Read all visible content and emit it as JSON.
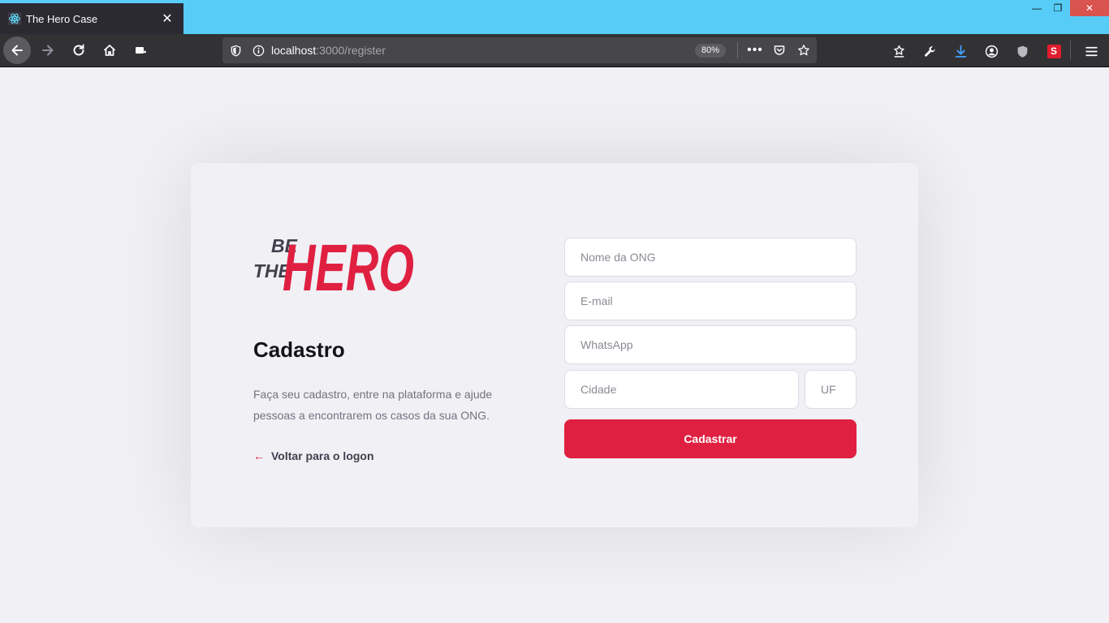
{
  "browser": {
    "tab_title": "The Hero Case",
    "url_host": "localhost",
    "url_rest": ":3000/register",
    "zoom": "80%",
    "colors": {
      "titlebar": "#56ccf7",
      "chrome": "#323234"
    }
  },
  "page": {
    "logo": {
      "line1": "BE",
      "line2": "THE",
      "word": "HERO"
    },
    "heading": "Cadastro",
    "description": "Faça seu cadastro, entre na plataforma e ajude pessoas a encontrarem os casos da sua ONG.",
    "back_link": "Voltar para o logon",
    "form": {
      "name_placeholder": "Nome da ONG",
      "email_placeholder": "E-mail",
      "whatsapp_placeholder": "WhatsApp",
      "city_placeholder": "Cidade",
      "uf_placeholder": "UF",
      "submit_label": "Cadastrar"
    },
    "colors": {
      "accent": "#e02041",
      "background": "#f0f0f5",
      "text": "#13131a"
    }
  }
}
